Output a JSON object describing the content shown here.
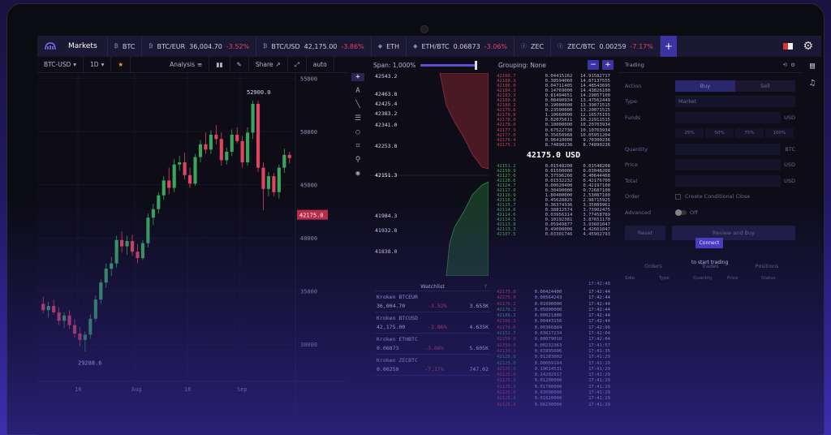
{
  "tabbar": {
    "markets": "Markets",
    "tabs": [
      {
        "label": "BTC",
        "price": "",
        "change": ""
      },
      {
        "label": "BTC/EUR",
        "price": "36,004.70",
        "change": "-3.52%"
      },
      {
        "label": "BTC/USD",
        "price": "42,175.00",
        "change": "-3.86%"
      },
      {
        "label": "ETH",
        "price": "",
        "change": ""
      },
      {
        "label": "ETH/BTC",
        "price": "0.06873",
        "change": "-3.06%"
      },
      {
        "label": "ZEC",
        "price": "",
        "change": ""
      },
      {
        "label": "ZEC/BTC",
        "price": "0.00259",
        "change": "-7.17%"
      }
    ],
    "add_label": "+"
  },
  "toolbar": {
    "pair": "BTC-USD",
    "interval": "1D",
    "analysis": "Analysis",
    "share": "Share",
    "auto": "auto"
  },
  "chart_data": {
    "type": "candlestick",
    "x_ticks": [
      "16",
      "Aug",
      "16",
      "Sep"
    ],
    "y_ticks": [
      "55000",
      "50000",
      "45000",
      "40000",
      "35000",
      "30000"
    ],
    "ylim": [
      26500,
      55500
    ],
    "high_label": "52900.0",
    "low_label": "29288.6",
    "current_price": "42175.0",
    "candles": [
      {
        "o": 33800,
        "h": 34500,
        "l": 32900,
        "c": 33200
      },
      {
        "o": 33200,
        "h": 34000,
        "l": 32500,
        "c": 33600
      },
      {
        "o": 33600,
        "h": 34200,
        "l": 32800,
        "c": 33000
      },
      {
        "o": 33000,
        "h": 33500,
        "l": 31800,
        "c": 32200
      },
      {
        "o": 32200,
        "h": 33000,
        "l": 31500,
        "c": 32700
      },
      {
        "o": 32700,
        "h": 33200,
        "l": 31400,
        "c": 31800
      },
      {
        "o": 31800,
        "h": 32400,
        "l": 30600,
        "c": 31000
      },
      {
        "o": 31000,
        "h": 31600,
        "l": 29800,
        "c": 30400
      },
      {
        "o": 30400,
        "h": 31200,
        "l": 29288,
        "c": 30900
      },
      {
        "o": 30900,
        "h": 32800,
        "l": 30500,
        "c": 32400
      },
      {
        "o": 32400,
        "h": 34600,
        "l": 32100,
        "c": 34200
      },
      {
        "o": 34200,
        "h": 36100,
        "l": 33800,
        "c": 35800
      },
      {
        "o": 35800,
        "h": 37600,
        "l": 35300,
        "c": 37100
      },
      {
        "o": 37100,
        "h": 38200,
        "l": 36400,
        "c": 37600
      },
      {
        "o": 37600,
        "h": 40200,
        "l": 37200,
        "c": 39800
      },
      {
        "o": 39800,
        "h": 40600,
        "l": 38600,
        "c": 39200
      },
      {
        "o": 39200,
        "h": 40200,
        "l": 38400,
        "c": 39700
      },
      {
        "o": 39700,
        "h": 40300,
        "l": 38300,
        "c": 38700
      },
      {
        "o": 38700,
        "h": 39400,
        "l": 37600,
        "c": 38100
      },
      {
        "o": 38100,
        "h": 39800,
        "l": 37900,
        "c": 39500
      },
      {
        "o": 39500,
        "h": 42300,
        "l": 39100,
        "c": 41900
      },
      {
        "o": 41900,
        "h": 43200,
        "l": 41200,
        "c": 42700
      },
      {
        "o": 42700,
        "h": 44300,
        "l": 42300,
        "c": 44000
      },
      {
        "o": 44000,
        "h": 45800,
        "l": 43600,
        "c": 45400
      },
      {
        "o": 45400,
        "h": 46600,
        "l": 44100,
        "c": 44700
      },
      {
        "o": 44700,
        "h": 47400,
        "l": 44300,
        "c": 46900
      },
      {
        "o": 46900,
        "h": 47700,
        "l": 46300,
        "c": 47100
      },
      {
        "o": 47100,
        "h": 48000,
        "l": 45500,
        "c": 45900
      },
      {
        "o": 45900,
        "h": 46600,
        "l": 44700,
        "c": 45100
      },
      {
        "o": 45100,
        "h": 47900,
        "l": 44900,
        "c": 47600
      },
      {
        "o": 47600,
        "h": 49200,
        "l": 47100,
        "c": 48800
      },
      {
        "o": 48800,
        "h": 49900,
        "l": 47900,
        "c": 48300
      },
      {
        "o": 48300,
        "h": 50100,
        "l": 47900,
        "c": 49700
      },
      {
        "o": 49700,
        "h": 50600,
        "l": 48800,
        "c": 49300
      },
      {
        "o": 49300,
        "h": 49900,
        "l": 46800,
        "c": 47300
      },
      {
        "o": 47300,
        "h": 48500,
        "l": 46900,
        "c": 48100
      },
      {
        "o": 48100,
        "h": 50200,
        "l": 47700,
        "c": 49700
      },
      {
        "o": 49700,
        "h": 50400,
        "l": 48900,
        "c": 49100
      },
      {
        "o": 49100,
        "h": 49600,
        "l": 46600,
        "c": 47100
      },
      {
        "o": 47100,
        "h": 50400,
        "l": 46800,
        "c": 49900
      },
      {
        "o": 49900,
        "h": 52900,
        "l": 49300,
        "c": 52600
      },
      {
        "o": 52600,
        "h": 52900,
        "l": 46200,
        "c": 46600
      },
      {
        "o": 46600,
        "h": 47100,
        "l": 42600,
        "c": 44600
      },
      {
        "o": 44600,
        "h": 46200,
        "l": 43900,
        "c": 45800
      },
      {
        "o": 45800,
        "h": 46100,
        "l": 43900,
        "c": 44300
      },
      {
        "o": 44300,
        "h": 46900,
        "l": 43700,
        "c": 46600
      },
      {
        "o": 46600,
        "h": 48400,
        "l": 46100,
        "c": 47800
      },
      {
        "o": 47800,
        "h": 48100,
        "l": 47000,
        "c": 47500
      }
    ]
  },
  "depth": {
    "span_label": "Span: 1,000%",
    "asks": [
      "42543.2",
      "42463.8",
      "42425.4",
      "42383.2",
      "42341.0",
      "42253.8"
    ],
    "mid": "42151.3",
    "bids": [
      "41984.3",
      "41932.8",
      "41838.0"
    ]
  },
  "orderbook": {
    "grouping": "Grouping: None",
    "minus": "−",
    "plus": "+",
    "mid_price": "42175.0 USD",
    "asks": [
      [
        "42188.7",
        "0.04415162",
        "14.91582717"
      ],
      [
        "42188.3",
        "0.38594060",
        "14.87137555"
      ],
      [
        "42186.0",
        "0.04711405",
        "14.48543695"
      ],
      [
        "42184.3",
        "0.14769000",
        "14.43826100"
      ],
      [
        "42183.3",
        "0.81494651",
        "14.29057100"
      ],
      [
        "42180.8",
        "0.08490934",
        "13.47562449"
      ],
      [
        "42180.2",
        "0.19000000",
        "13.39071515"
      ],
      [
        "42179.6",
        "0.23500000",
        "13.20071515"
      ],
      [
        "42178.8",
        "1.10660000",
        "12.16575155"
      ],
      [
        "42178.0",
        "0.02075611",
        "10.22911515"
      ],
      [
        "42178.0",
        "0.10000000",
        "10.20703934"
      ],
      [
        "42177.9",
        "0.67522730",
        "10.10703934"
      ],
      [
        "42177.0",
        "0.35650968",
        "10.05951204"
      ],
      [
        "42176.4",
        "0.96410000",
        "9.70300236"
      ],
      [
        "42175.1",
        "8.74890236",
        "8.74890236"
      ]
    ],
    "bids": [
      [
        "42151.2",
        "0.01548208",
        "0.01548208"
      ],
      [
        "42150.9",
        "0.01500000",
        "0.03048208"
      ],
      [
        "42127.6",
        "0.37596260",
        "0.40644468"
      ],
      [
        "42126.6",
        "0.01532232",
        "0.42176700"
      ],
      [
        "42124.7",
        "0.00020400",
        "0.42197100"
      ],
      [
        "42117.0",
        "0.30490000",
        "0.72687100"
      ],
      [
        "42116.9",
        "1.80400000",
        "2.53087100"
      ],
      [
        "42116.0",
        "0.45628825",
        "2.98715925"
      ],
      [
        "42115.7",
        "0.36374336",
        "3.35089961"
      ],
      [
        "42114.6",
        "0.38812574",
        "3.73902475"
      ],
      [
        "42114.6",
        "0.03956314",
        "3.77458789"
      ],
      [
        "42114.5",
        "0.10192381",
        "3.87651170"
      ],
      [
        "42113.8",
        "0.05949877",
        "3.93601047"
      ],
      [
        "42113.3",
        "0.49000000",
        "4.42601047"
      ],
      [
        "42107.5",
        "0.03301746",
        "4.45902793"
      ]
    ]
  },
  "trades": {
    "header_time": "17:42:48",
    "rows": [
      [
        "42175.0",
        "0.00424400",
        "17:42:44",
        "r"
      ],
      [
        "42175.0",
        "0.00564243",
        "17:42:44",
        "r"
      ],
      [
        "42176.2",
        "0.01000000",
        "17:42:44",
        "r"
      ],
      [
        "42176.2",
        "0.05000000",
        "17:42:44",
        "g"
      ],
      [
        "42186.3",
        "0.00021886",
        "17:42:44",
        "g"
      ],
      [
        "42186.3",
        "0.00443156",
        "17:42:44",
        "r"
      ],
      [
        "42178.6",
        "0.00366884",
        "17:42:06",
        "r"
      ],
      [
        "42152.7",
        "0.03617234",
        "17:42:04",
        "g"
      ],
      [
        "42150.0",
        "0.00079010",
        "17:42:04",
        "r"
      ],
      [
        "42150.0",
        "0.00232363",
        "17:41:57",
        "r"
      ],
      [
        "42130.3",
        "0.03995606",
        "17:41:35",
        "r"
      ],
      [
        "42125.0",
        "0.01283002",
        "17:41:29",
        "g"
      ],
      [
        "42125.0",
        "0.00069194",
        "17:41:29",
        "g"
      ],
      [
        "42125.0",
        "0.19614531",
        "17:41:29",
        "r"
      ],
      [
        "42125.0",
        "0.14202917",
        "17:41:29",
        "r"
      ],
      [
        "42125.0",
        "0.01200000",
        "17:41:29",
        "r"
      ],
      [
        "42125.0",
        "0.01700000",
        "17:41:29",
        "r"
      ],
      [
        "42125.0",
        "0.03000000",
        "17:41:29",
        "r"
      ],
      [
        "42125.0",
        "0.01020000",
        "17:41:29",
        "r"
      ],
      [
        "42125.0",
        "0.00290000",
        "17:41:29",
        "r"
      ]
    ]
  },
  "watchlist": {
    "title": "Watchlist",
    "help": "?",
    "items": [
      {
        "name": "Kroken  BTCEUR",
        "price": "36,004.70",
        "change": "-3.52%",
        "volume": "3.653K"
      },
      {
        "name": "Kroken  BTCUSD",
        "price": "42,175.00",
        "change": "-3.86%",
        "volume": "4.635K"
      },
      {
        "name": "Kroken  ETHBTC",
        "price": "0.06873",
        "change": "-3.06%",
        "volume": "5.605K"
      },
      {
        "name": "Kroken  ZECBTC",
        "price": "0.00259",
        "change": "-7.17%",
        "volume": "747.02"
      }
    ]
  },
  "trading": {
    "title": "Trading",
    "action_label": "Action",
    "buy": "Buy",
    "sell": "Sell",
    "type_label": "Type",
    "type_value": "Market",
    "funds_label": "Funds",
    "funds_unit": "USD",
    "pcts": [
      "25%",
      "50%",
      "75%",
      "100%"
    ],
    "quantity_label": "Quantity",
    "quantity_unit": "BTC",
    "price_label": "Price",
    "price_unit": "USD",
    "total_label": "Total",
    "total_unit": "USD",
    "order_label": "Order",
    "conditional": "Create Conditional Close",
    "advanced_label": "Advanced",
    "off": "Off",
    "reset": "Reset",
    "review": "Review and Buy",
    "connect": "Connect",
    "connect_sub": "to start trading",
    "tabs": [
      "Orders",
      "Trades",
      "Positions"
    ],
    "cols": [
      "Side",
      "Type",
      "Quantity",
      "Price",
      "Status"
    ]
  }
}
